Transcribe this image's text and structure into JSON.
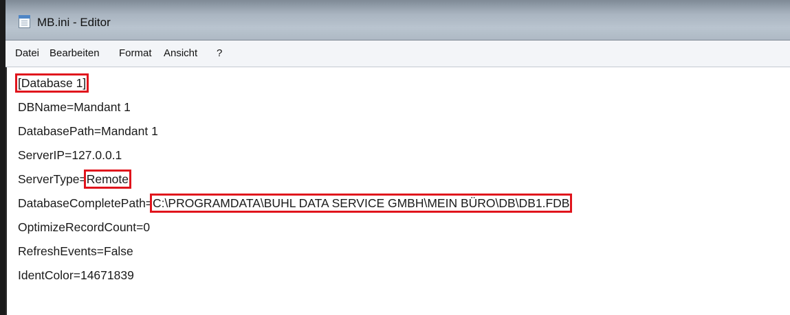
{
  "window": {
    "title": "MB.ini - Editor",
    "icon": "notepad-icon"
  },
  "menu": {
    "items": [
      "Datei",
      "Bearbeiten",
      "Format",
      "Ansicht",
      "?"
    ]
  },
  "editor": {
    "lines": [
      {
        "key": "[Database 1]",
        "value": ""
      },
      {
        "key": "DBName=",
        "value": "Mandant 1"
      },
      {
        "key": "DatabasePath=",
        "value": "Mandant 1"
      },
      {
        "key": "ServerIP=",
        "value": "127.0.0.1"
      },
      {
        "key": "ServerType=",
        "value": "Remote"
      },
      {
        "key": "DatabaseCompletePath=",
        "value": "C:\\PROGRAMDATA\\BUHL DATA SERVICE GMBH\\MEIN BÜRO\\DB\\DB1.FDB"
      },
      {
        "key": "OptimizeRecordCount=",
        "value": "0"
      },
      {
        "key": "RefreshEvents=",
        "value": "False"
      },
      {
        "key": "IdentColor=",
        "value": "14671839"
      }
    ]
  },
  "colors": {
    "highlight": "#e0141c",
    "title_bar": "#a9b4c0",
    "menu_bar": "#f3f5f8"
  }
}
